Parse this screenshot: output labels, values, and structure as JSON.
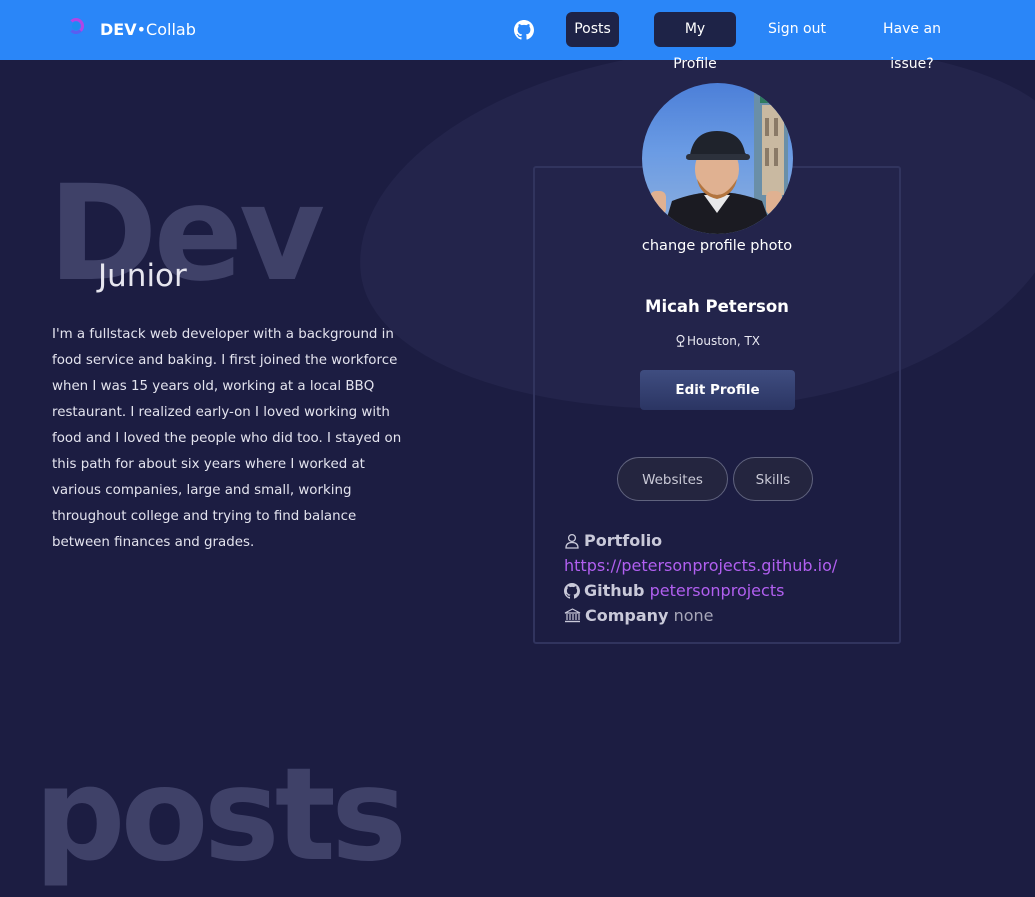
{
  "brand": {
    "dev": "DEV",
    "dot": "•",
    "collab": "Collab"
  },
  "nav": {
    "github_icon": "github-icon",
    "posts": "Posts",
    "my_profile": "My Profile",
    "sign_out": "Sign out",
    "issue": "Have an issue?"
  },
  "hero": {
    "big_word": "Dev",
    "level": "Junior",
    "bio": "I'm a fullstack web developer with a background in food service and baking. I first joined the workforce when I was 15 years old, working at a local BBQ restaurant. I realized early-on I loved working with food and I loved the people who did too. I stayed on this path for about six years where I worked at various companies, large and small, working throughout college and trying to find balance between finances and grades."
  },
  "profile": {
    "change_photo": "change profile photo",
    "name": "Micah Peterson",
    "location": "Houston, TX",
    "edit_button": "Edit Profile",
    "tabs": [
      "Websites",
      "Skills"
    ],
    "portfolio_label": "Portfolio",
    "portfolio_url": "https://petersonprojects.github.io/",
    "github_label": "Github",
    "github_value": "petersonprojects",
    "company_label": "Company",
    "company_value": "none"
  },
  "posts_section": {
    "big_word": "posts"
  },
  "colors": {
    "navbar": "#2a86f8",
    "background": "#1c1d42",
    "link": "#b15ff0",
    "big_text": "#3f4168"
  }
}
